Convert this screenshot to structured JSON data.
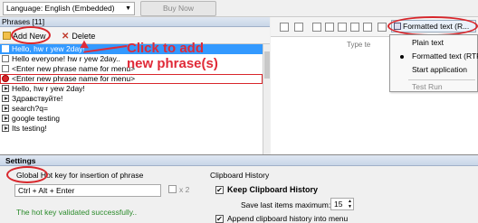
{
  "topbar": {
    "language": "Language: English (Embedded)",
    "buy_now": "Buy Now"
  },
  "phrases": {
    "header": "Phrases [11]",
    "add_new": "Add New",
    "delete": "Delete",
    "items": [
      {
        "text": "Hello, hw r yew 2day!",
        "selected": true
      },
      {
        "text": "Hello everyone! hw r yew 2day.."
      },
      {
        "text": "<Enter new phrase name for menu>"
      },
      {
        "text": "<Enter new phrase name for menu>",
        "highlight": true
      },
      {
        "text": "Hello, hw r yew 2day!"
      },
      {
        "text": "Здравствуйте!"
      },
      {
        "text": "search?q="
      },
      {
        "text": "google testing"
      },
      {
        "text": "Its testing!"
      }
    ]
  },
  "annotation": {
    "line1": "Click to add",
    "line2": "new phrase(s)"
  },
  "editor": {
    "type_hint": "Type te"
  },
  "format_menu": {
    "button": "Formatted text (R...",
    "items": [
      {
        "label": "Plain text",
        "checked": false
      },
      {
        "label": "Formatted text (RTF)",
        "checked": true
      },
      {
        "label": "Start application",
        "checked": false
      },
      {
        "label": "Test Run",
        "checked": false,
        "disabled": true
      }
    ]
  },
  "settings": {
    "header": "Settings",
    "hotkey_label": "Global Hot key for insertion of phrase",
    "hotkey_value": "Ctrl + Alt + Enter",
    "x2_label": "x 2",
    "hotkey_status": "The hot key validated successfully..",
    "clipboard_history_label": "Clipboard History",
    "keep_label": "Keep Clipboard History",
    "save_label": "Save last items maximum:",
    "save_value": "15",
    "append_label": "Append clipboard history into menu"
  }
}
